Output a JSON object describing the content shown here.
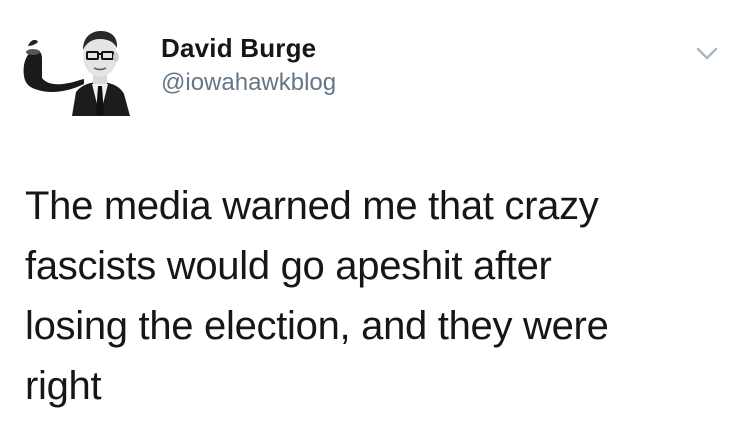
{
  "author": {
    "display_name": "David Burge",
    "handle": "@iowahawkblog"
  },
  "tweet": {
    "lines": [
      "The media warned me that crazy",
      "fascists would go apeshit after",
      "losing the election, and they were",
      "right"
    ]
  },
  "icons": {
    "menu": "chevron-down-icon",
    "avatar": "avatar-man-with-pipe"
  },
  "colors": {
    "name": "#14171a",
    "handle": "#657786",
    "caret": "#aab8c2"
  }
}
